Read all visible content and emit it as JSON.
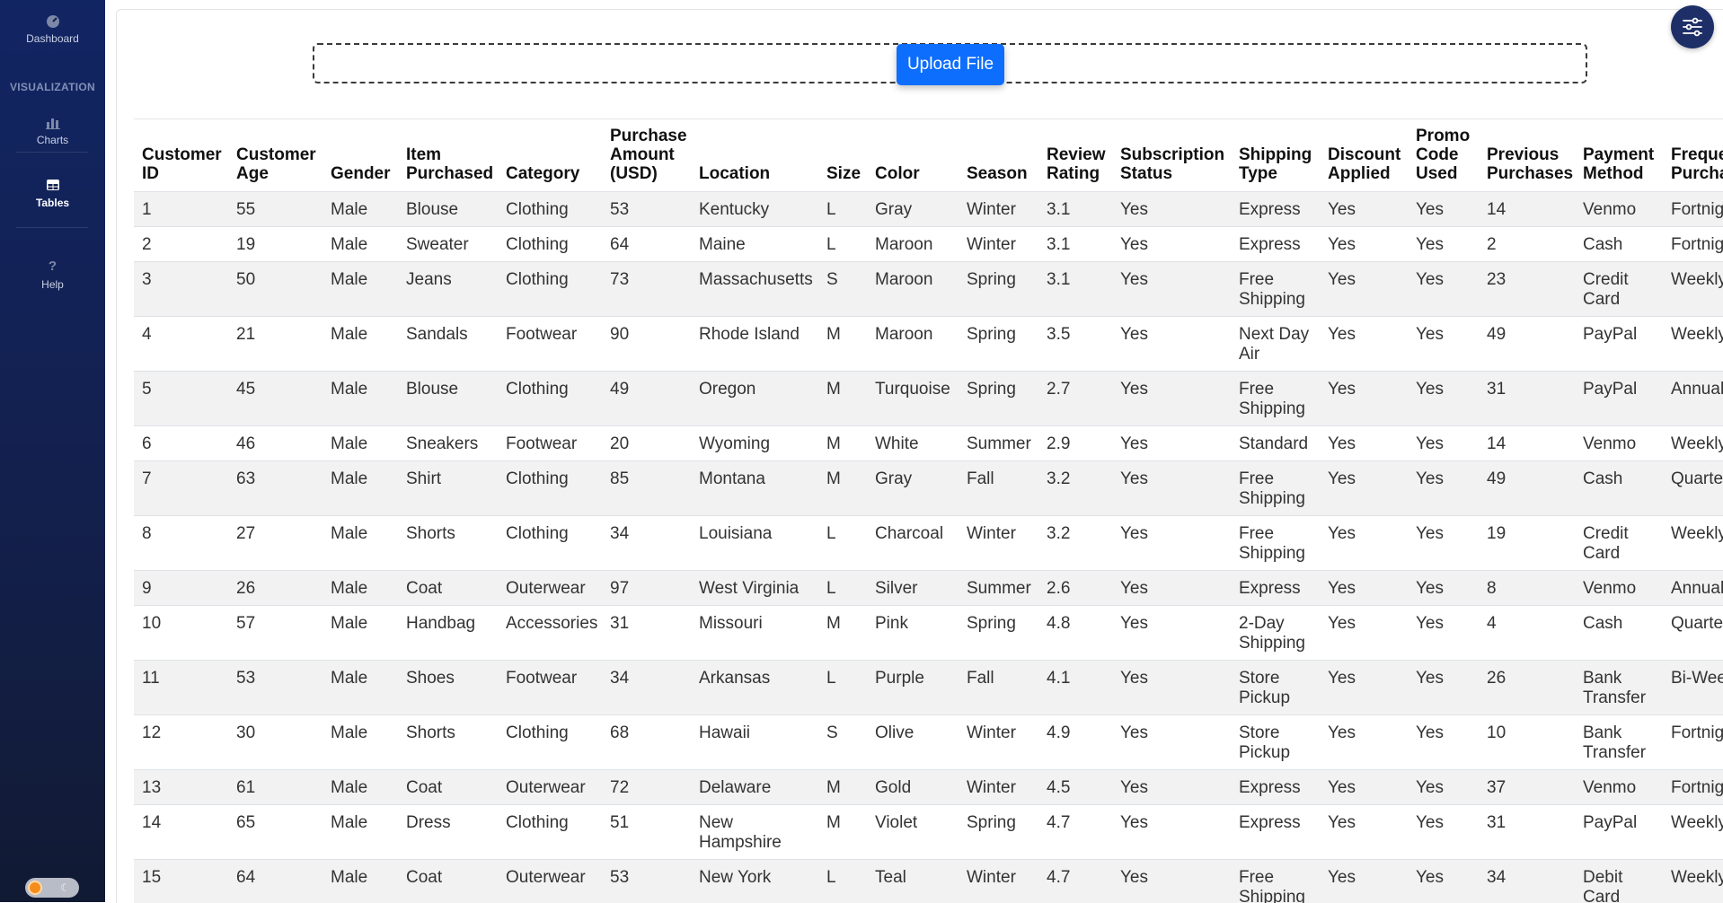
{
  "sidebar": {
    "dashboard_label": "Dashboard",
    "section_label": "VISUALIZATION",
    "charts_label": "Charts",
    "tables_label": "Tables",
    "help_label": "Help",
    "dashboard_icon": "gauge-icon",
    "charts_icon": "bar-chart-icon",
    "tables_icon": "table-icon",
    "help_icon": "question-icon",
    "theme_toggle": "light-dark-toggle"
  },
  "upload": {
    "button_label": "Upload File"
  },
  "settings": {
    "icon": "sliders-icon"
  },
  "colors": {
    "sidebar_bg": "#13204d",
    "accent": "#0d6efd",
    "fab_bg": "#1e2f68",
    "row_stripe": "#f2f2f2"
  },
  "table": {
    "columns": [
      "Customer ID",
      "Customer Age",
      "Gender",
      "Item Purchased",
      "Category",
      "Purchase Amount (USD)",
      "Location",
      "Size",
      "Color",
      "Season",
      "Review Rating",
      "Subscription Status",
      "Shipping Type",
      "Discount Applied",
      "Promo Code Used",
      "Previous Purchases",
      "Payment Method",
      "Frequency of Purchases"
    ],
    "rows": [
      [
        "1",
        "55",
        "Male",
        "Blouse",
        "Clothing",
        "53",
        "Kentucky",
        "L",
        "Gray",
        "Winter",
        "3.1",
        "Yes",
        "Express",
        "Yes",
        "Yes",
        "14",
        "Venmo",
        "Fortnightly"
      ],
      [
        "2",
        "19",
        "Male",
        "Sweater",
        "Clothing",
        "64",
        "Maine",
        "L",
        "Maroon",
        "Winter",
        "3.1",
        "Yes",
        "Express",
        "Yes",
        "Yes",
        "2",
        "Cash",
        "Fortnightly"
      ],
      [
        "3",
        "50",
        "Male",
        "Jeans",
        "Clothing",
        "73",
        "Massachusetts",
        "S",
        "Maroon",
        "Spring",
        "3.1",
        "Yes",
        "Free Shipping",
        "Yes",
        "Yes",
        "23",
        "Credit Card",
        "Weekly"
      ],
      [
        "4",
        "21",
        "Male",
        "Sandals",
        "Footwear",
        "90",
        "Rhode Island",
        "M",
        "Maroon",
        "Spring",
        "3.5",
        "Yes",
        "Next Day Air",
        "Yes",
        "Yes",
        "49",
        "PayPal",
        "Weekly"
      ],
      [
        "5",
        "45",
        "Male",
        "Blouse",
        "Clothing",
        "49",
        "Oregon",
        "M",
        "Turquoise",
        "Spring",
        "2.7",
        "Yes",
        "Free Shipping",
        "Yes",
        "Yes",
        "31",
        "PayPal",
        "Annually"
      ],
      [
        "6",
        "46",
        "Male",
        "Sneakers",
        "Footwear",
        "20",
        "Wyoming",
        "M",
        "White",
        "Summer",
        "2.9",
        "Yes",
        "Standard",
        "Yes",
        "Yes",
        "14",
        "Venmo",
        "Weekly"
      ],
      [
        "7",
        "63",
        "Male",
        "Shirt",
        "Clothing",
        "85",
        "Montana",
        "M",
        "Gray",
        "Fall",
        "3.2",
        "Yes",
        "Free Shipping",
        "Yes",
        "Yes",
        "49",
        "Cash",
        "Quarterly"
      ],
      [
        "8",
        "27",
        "Male",
        "Shorts",
        "Clothing",
        "34",
        "Louisiana",
        "L",
        "Charcoal",
        "Winter",
        "3.2",
        "Yes",
        "Free Shipping",
        "Yes",
        "Yes",
        "19",
        "Credit Card",
        "Weekly"
      ],
      [
        "9",
        "26",
        "Male",
        "Coat",
        "Outerwear",
        "97",
        "West Virginia",
        "L",
        "Silver",
        "Summer",
        "2.6",
        "Yes",
        "Express",
        "Yes",
        "Yes",
        "8",
        "Venmo",
        "Annually"
      ],
      [
        "10",
        "57",
        "Male",
        "Handbag",
        "Accessories",
        "31",
        "Missouri",
        "M",
        "Pink",
        "Spring",
        "4.8",
        "Yes",
        "2-Day Shipping",
        "Yes",
        "Yes",
        "4",
        "Cash",
        "Quarterly"
      ],
      [
        "11",
        "53",
        "Male",
        "Shoes",
        "Footwear",
        "34",
        "Arkansas",
        "L",
        "Purple",
        "Fall",
        "4.1",
        "Yes",
        "Store Pickup",
        "Yes",
        "Yes",
        "26",
        "Bank Transfer",
        "Bi-Weekly"
      ],
      [
        "12",
        "30",
        "Male",
        "Shorts",
        "Clothing",
        "68",
        "Hawaii",
        "S",
        "Olive",
        "Winter",
        "4.9",
        "Yes",
        "Store Pickup",
        "Yes",
        "Yes",
        "10",
        "Bank Transfer",
        "Fortnightly"
      ],
      [
        "13",
        "61",
        "Male",
        "Coat",
        "Outerwear",
        "72",
        "Delaware",
        "M",
        "Gold",
        "Winter",
        "4.5",
        "Yes",
        "Express",
        "Yes",
        "Yes",
        "37",
        "Venmo",
        "Fortnightly"
      ],
      [
        "14",
        "65",
        "Male",
        "Dress",
        "Clothing",
        "51",
        "New Hampshire",
        "M",
        "Violet",
        "Spring",
        "4.7",
        "Yes",
        "Express",
        "Yes",
        "Yes",
        "31",
        "PayPal",
        "Weekly"
      ],
      [
        "15",
        "64",
        "Male",
        "Coat",
        "Outerwear",
        "53",
        "New York",
        "L",
        "Teal",
        "Winter",
        "4.7",
        "Yes",
        "Free Shipping",
        "Yes",
        "Yes",
        "34",
        "Debit Card",
        "Weekly"
      ]
    ]
  }
}
